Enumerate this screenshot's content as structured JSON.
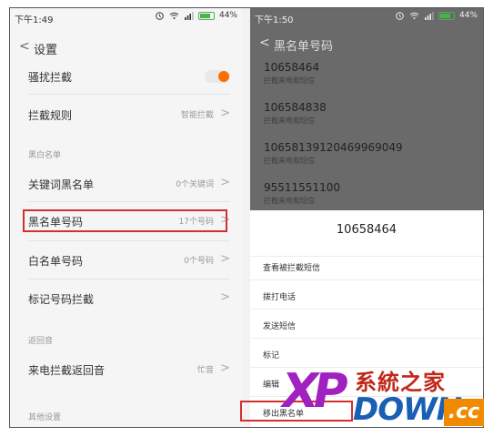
{
  "left": {
    "status": {
      "time": "下午1:49",
      "battery": "44%"
    },
    "header": {
      "back": "<",
      "title": "设置"
    },
    "rows": {
      "harass": {
        "label": "骚扰拦截"
      },
      "rules": {
        "label": "拦截规则",
        "value": "智能拦截"
      },
      "section_blackwhite": "黑白名单",
      "keyword": {
        "label": "关键词黑名单",
        "value": "0个关键词"
      },
      "blacklist": {
        "label": "黑名单号码",
        "value": "17个号码"
      },
      "whitelist": {
        "label": "白名单号码",
        "value": "0个号码"
      },
      "marked": {
        "label": "标记号码拦截"
      },
      "section_return": "返回音",
      "ringback": {
        "label": "来电拦截返回音",
        "value": "忙音"
      },
      "section_other": "其他设置"
    },
    "chevron": ">"
  },
  "right": {
    "status": {
      "time": "下午1:50",
      "battery": "44%"
    },
    "header": {
      "back": "<",
      "title": "黑名单号码"
    },
    "numbers": [
      {
        "number": "10658464",
        "sub": "拦截来电和短信"
      },
      {
        "number": "106584838",
        "sub": "拦截来电和短信"
      },
      {
        "number": "1065813912046996904​9",
        "sub": "拦截来电和短信"
      },
      {
        "number": "95511551100",
        "sub": "拦截来电和短信"
      }
    ],
    "sheet": {
      "title": "10658464",
      "actions": [
        "查看被拦截短信",
        "拨打电话",
        "发送短信",
        "标记",
        "编辑",
        "移出黑名单"
      ]
    }
  },
  "watermark": {
    "xp": "XP",
    "cn": "系統之家",
    "down": "DOWN",
    "cc": ".cc"
  },
  "colors": {
    "toggle_on": "#ff6d00",
    "highlight": "#d32f2f",
    "overlay": "#6a6a6a"
  }
}
